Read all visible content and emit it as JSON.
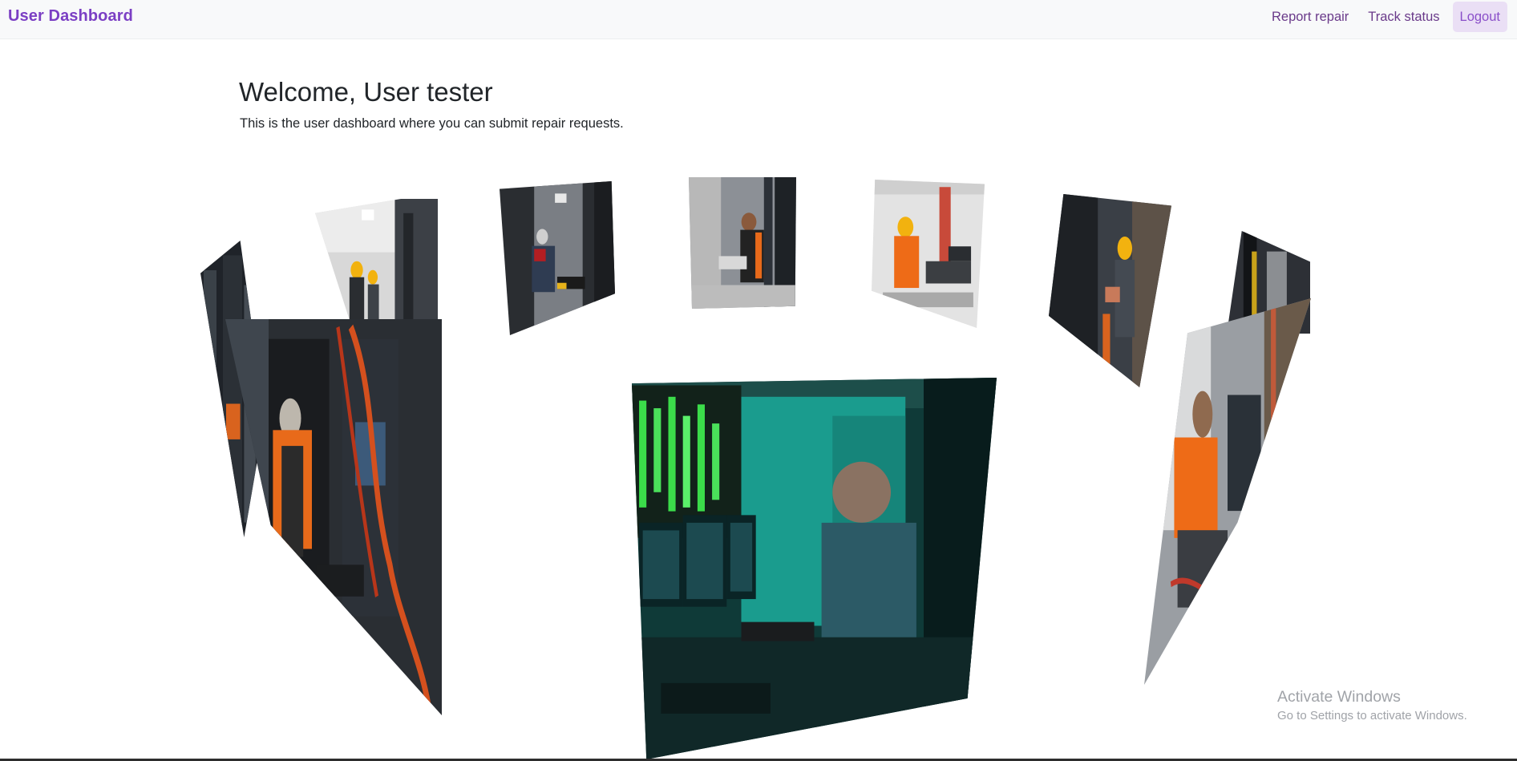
{
  "navbar": {
    "brand": "User Dashboard",
    "links": [
      {
        "label": "Report repair"
      },
      {
        "label": "Track status"
      },
      {
        "label": "Logout"
      }
    ]
  },
  "main": {
    "title": "Welcome, User tester",
    "subtitle": "This is the user dashboard where you can submit repair requests."
  },
  "carousel": {
    "images": [
      {
        "subject": "technician-at-server-rack-photo"
      },
      {
        "subject": "technicians-in-hard-hats-photo"
      },
      {
        "subject": "technician-on-keyboard-photo"
      },
      {
        "subject": "technician-at-workstation-photo"
      },
      {
        "subject": "technician-with-laptops-photo"
      },
      {
        "subject": "technician-in-server-room-photo"
      },
      {
        "subject": "technician-at-panel-photo"
      },
      {
        "subject": "technician-cable-repair-photo"
      },
      {
        "subject": "technician-on-teal-monitors-photo"
      }
    ]
  },
  "watermark": {
    "title": "Activate Windows",
    "subtitle": "Go to Settings to activate Windows."
  }
}
